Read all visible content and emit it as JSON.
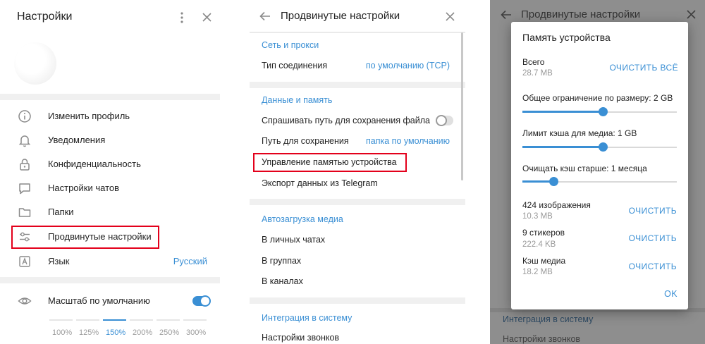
{
  "settings": {
    "title": "Настройки",
    "menu": [
      {
        "label": "Изменить профиль",
        "icon": "info-icon"
      },
      {
        "label": "Уведомления",
        "icon": "bell-icon"
      },
      {
        "label": "Конфиденциальность",
        "icon": "lock-icon"
      },
      {
        "label": "Настройки чатов",
        "icon": "chat-bubble-icon"
      },
      {
        "label": "Папки",
        "icon": "folder-icon"
      },
      {
        "label": "Продвинутые настройки",
        "icon": "sliders-icon"
      },
      {
        "label": "Язык",
        "icon": "language-icon",
        "value": "Русский"
      }
    ],
    "scale_label": "Масштаб по умолчанию",
    "scale_enabled": true,
    "zoom_options": [
      "100%",
      "125%",
      "150%",
      "200%",
      "250%",
      "300%"
    ],
    "zoom_selected": "150%"
  },
  "advanced": {
    "title": "Продвинутые настройки",
    "network": {
      "header": "Сеть и прокси",
      "connection_label": "Тип соединения",
      "connection_value": "по умолчанию (TCP)"
    },
    "data": {
      "header": "Данные и память",
      "ask_path_label": "Спрашивать путь для сохранения файла",
      "ask_path_enabled": false,
      "save_path_label": "Путь для сохранения",
      "save_path_value": "папка по умолчанию",
      "storage_label": "Управление памятью устройства",
      "export_label": "Экспорт данных из Telegram"
    },
    "autodownload": {
      "header": "Автозагрузка медиа",
      "private": "В личных чатах",
      "groups": "В группах",
      "channels": "В каналах"
    },
    "integration": {
      "header": "Интеграция в систему",
      "calls": "Настройки звонков"
    }
  },
  "storage_dialog": {
    "bg_title": "Продвинутые настройки",
    "bg_integration": "Интеграция в систему",
    "bg_calls": "Настройки звонков",
    "title": "Память устройства",
    "total_label": "Всего",
    "total_value": "28.7 MB",
    "clear_all": "ОЧИСТИТЬ ВСЁ",
    "size_limit_label": "Общее ограничение по размеру: 2 GB",
    "size_limit_fraction": 0.52,
    "media_limit_label": "Лимит кэша для медиа: 1 GB",
    "media_limit_fraction": 0.52,
    "clear_older_label": "Очищать кэш старше: 1 месяца",
    "clear_older_fraction": 0.2,
    "items": [
      {
        "label": "424 изображения",
        "size": "10.3 MB",
        "action": "ОЧИСТИТЬ"
      },
      {
        "label": "9 стикеров",
        "size": "222.4 KB",
        "action": "ОЧИСТИТЬ"
      },
      {
        "label": "Кэш медиа",
        "size": "18.2 MB",
        "action": "ОЧИСТИТЬ"
      }
    ],
    "ok": "OK"
  },
  "colors": {
    "accent": "#3a8fd4",
    "highlight": "#e3001b",
    "overlay": "#8e8e8e"
  }
}
